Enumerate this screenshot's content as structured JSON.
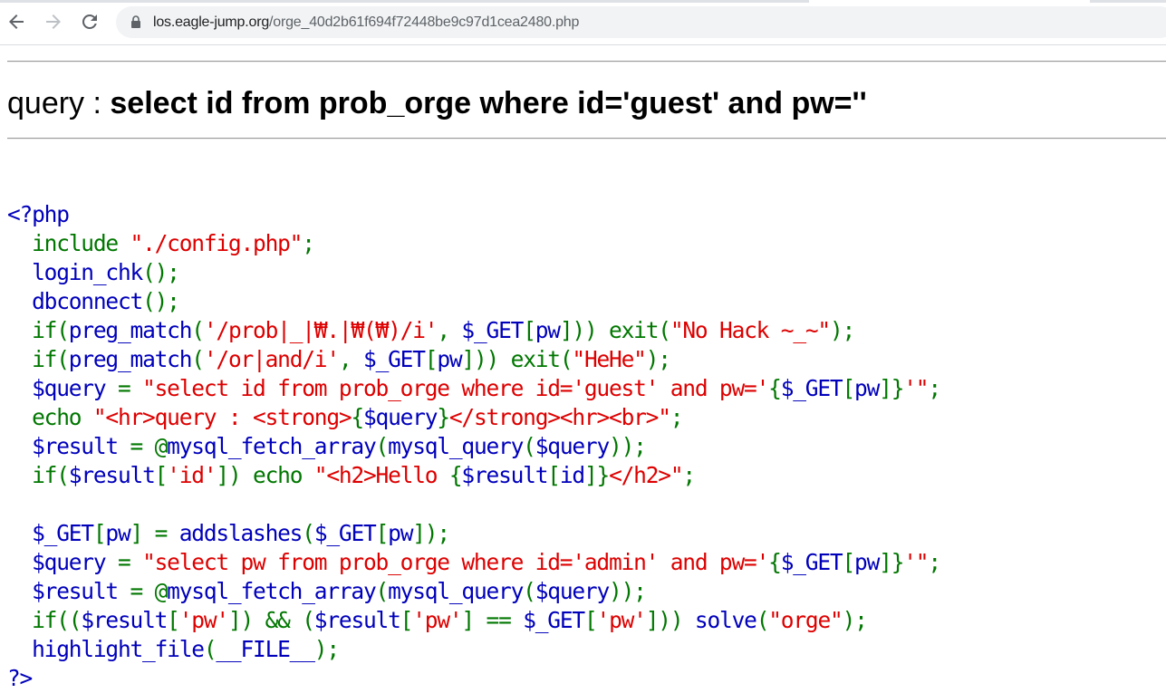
{
  "browser": {
    "url_host": "los.eagle-jump.org",
    "url_path": "/orge_40d2b61f694f72448be9c97d1cea2480.php",
    "icons": [
      "back-arrow-icon",
      "forward-arrow-icon",
      "reload-icon",
      "lock-icon"
    ],
    "colors": {
      "omnibox_bg": "#f1f3f4",
      "icon": "#5f6368"
    }
  },
  "page": {
    "query_label": "query : ",
    "query_text": "select id from prob_orge where id='guest' and pw=''"
  },
  "source": {
    "colors": {
      "default": "#0000bb",
      "string": "#dd0000",
      "keyword": "#007700"
    },
    "lines": [
      [
        {
          "t": "<?php",
          "c": "def"
        }
      ],
      [
        {
          "t": "  include ",
          "c": "kw"
        },
        {
          "t": "\"./config.php\"",
          "c": "str"
        },
        {
          "t": ";",
          "c": "kw"
        }
      ],
      [
        {
          "t": "  login_chk",
          "c": "def"
        },
        {
          "t": "();",
          "c": "kw"
        }
      ],
      [
        {
          "t": "  dbconnect",
          "c": "def"
        },
        {
          "t": "();",
          "c": "kw"
        }
      ],
      [
        {
          "t": "  if(",
          "c": "kw"
        },
        {
          "t": "preg_match",
          "c": "def"
        },
        {
          "t": "(",
          "c": "kw"
        },
        {
          "t": "'/prob|_|₩.|₩(₩)/i'",
          "c": "str"
        },
        {
          "t": ", ",
          "c": "kw"
        },
        {
          "t": "$_GET",
          "c": "def"
        },
        {
          "t": "[",
          "c": "kw"
        },
        {
          "t": "pw",
          "c": "def"
        },
        {
          "t": "])) exit(",
          "c": "kw"
        },
        {
          "t": "\"No Hack ~_~\"",
          "c": "str"
        },
        {
          "t": ");",
          "c": "kw"
        }
      ],
      [
        {
          "t": "  if(",
          "c": "kw"
        },
        {
          "t": "preg_match",
          "c": "def"
        },
        {
          "t": "(",
          "c": "kw"
        },
        {
          "t": "'/or|and/i'",
          "c": "str"
        },
        {
          "t": ", ",
          "c": "kw"
        },
        {
          "t": "$_GET",
          "c": "def"
        },
        {
          "t": "[",
          "c": "kw"
        },
        {
          "t": "pw",
          "c": "def"
        },
        {
          "t": "])) exit(",
          "c": "kw"
        },
        {
          "t": "\"HeHe\"",
          "c": "str"
        },
        {
          "t": ");",
          "c": "kw"
        }
      ],
      [
        {
          "t": "  $query ",
          "c": "def"
        },
        {
          "t": "= ",
          "c": "kw"
        },
        {
          "t": "\"select id from prob_orge where id='guest' and pw='",
          "c": "str"
        },
        {
          "t": "{",
          "c": "kw"
        },
        {
          "t": "$_GET",
          "c": "def"
        },
        {
          "t": "[",
          "c": "kw"
        },
        {
          "t": "pw",
          "c": "def"
        },
        {
          "t": "]}",
          "c": "kw"
        },
        {
          "t": "'\"",
          "c": "str"
        },
        {
          "t": ";",
          "c": "kw"
        }
      ],
      [
        {
          "t": "  echo ",
          "c": "kw"
        },
        {
          "t": "\"<hr>query : <strong>",
          "c": "str"
        },
        {
          "t": "{",
          "c": "kw"
        },
        {
          "t": "$query",
          "c": "def"
        },
        {
          "t": "}",
          "c": "kw"
        },
        {
          "t": "</strong><hr><br>\"",
          "c": "str"
        },
        {
          "t": ";",
          "c": "kw"
        }
      ],
      [
        {
          "t": "  $result ",
          "c": "def"
        },
        {
          "t": "= @",
          "c": "kw"
        },
        {
          "t": "mysql_fetch_array",
          "c": "def"
        },
        {
          "t": "(",
          "c": "kw"
        },
        {
          "t": "mysql_query",
          "c": "def"
        },
        {
          "t": "(",
          "c": "kw"
        },
        {
          "t": "$query",
          "c": "def"
        },
        {
          "t": "));",
          "c": "kw"
        }
      ],
      [
        {
          "t": "  if(",
          "c": "kw"
        },
        {
          "t": "$result",
          "c": "def"
        },
        {
          "t": "[",
          "c": "kw"
        },
        {
          "t": "'id'",
          "c": "str"
        },
        {
          "t": "]) echo ",
          "c": "kw"
        },
        {
          "t": "\"<h2>Hello ",
          "c": "str"
        },
        {
          "t": "{",
          "c": "kw"
        },
        {
          "t": "$result",
          "c": "def"
        },
        {
          "t": "[",
          "c": "kw"
        },
        {
          "t": "id",
          "c": "def"
        },
        {
          "t": "]}",
          "c": "kw"
        },
        {
          "t": "</h2>\"",
          "c": "str"
        },
        {
          "t": ";",
          "c": "kw"
        }
      ],
      [
        {
          "t": "",
          "c": "def"
        }
      ],
      [
        {
          "t": "  $_GET",
          "c": "def"
        },
        {
          "t": "[",
          "c": "kw"
        },
        {
          "t": "pw",
          "c": "def"
        },
        {
          "t": "] = ",
          "c": "kw"
        },
        {
          "t": "addslashes",
          "c": "def"
        },
        {
          "t": "(",
          "c": "kw"
        },
        {
          "t": "$_GET",
          "c": "def"
        },
        {
          "t": "[",
          "c": "kw"
        },
        {
          "t": "pw",
          "c": "def"
        },
        {
          "t": "]);",
          "c": "kw"
        }
      ],
      [
        {
          "t": "  $query ",
          "c": "def"
        },
        {
          "t": "= ",
          "c": "kw"
        },
        {
          "t": "\"select pw from prob_orge where id='admin' and pw='",
          "c": "str"
        },
        {
          "t": "{",
          "c": "kw"
        },
        {
          "t": "$_GET",
          "c": "def"
        },
        {
          "t": "[",
          "c": "kw"
        },
        {
          "t": "pw",
          "c": "def"
        },
        {
          "t": "]}",
          "c": "kw"
        },
        {
          "t": "'\"",
          "c": "str"
        },
        {
          "t": ";",
          "c": "kw"
        }
      ],
      [
        {
          "t": "  $result ",
          "c": "def"
        },
        {
          "t": "= @",
          "c": "kw"
        },
        {
          "t": "mysql_fetch_array",
          "c": "def"
        },
        {
          "t": "(",
          "c": "kw"
        },
        {
          "t": "mysql_query",
          "c": "def"
        },
        {
          "t": "(",
          "c": "kw"
        },
        {
          "t": "$query",
          "c": "def"
        },
        {
          "t": "));",
          "c": "kw"
        }
      ],
      [
        {
          "t": "  if((",
          "c": "kw"
        },
        {
          "t": "$result",
          "c": "def"
        },
        {
          "t": "[",
          "c": "kw"
        },
        {
          "t": "'pw'",
          "c": "str"
        },
        {
          "t": "]) && (",
          "c": "kw"
        },
        {
          "t": "$result",
          "c": "def"
        },
        {
          "t": "[",
          "c": "kw"
        },
        {
          "t": "'pw'",
          "c": "str"
        },
        {
          "t": "] == ",
          "c": "kw"
        },
        {
          "t": "$_GET",
          "c": "def"
        },
        {
          "t": "[",
          "c": "kw"
        },
        {
          "t": "'pw'",
          "c": "str"
        },
        {
          "t": "])) ",
          "c": "kw"
        },
        {
          "t": "solve",
          "c": "def"
        },
        {
          "t": "(",
          "c": "kw"
        },
        {
          "t": "\"orge\"",
          "c": "str"
        },
        {
          "t": ");",
          "c": "kw"
        }
      ],
      [
        {
          "t": "  highlight_file",
          "c": "def"
        },
        {
          "t": "(",
          "c": "kw"
        },
        {
          "t": "__FILE__",
          "c": "def"
        },
        {
          "t": ");",
          "c": "kw"
        }
      ],
      [
        {
          "t": "?>",
          "c": "def"
        }
      ]
    ]
  }
}
